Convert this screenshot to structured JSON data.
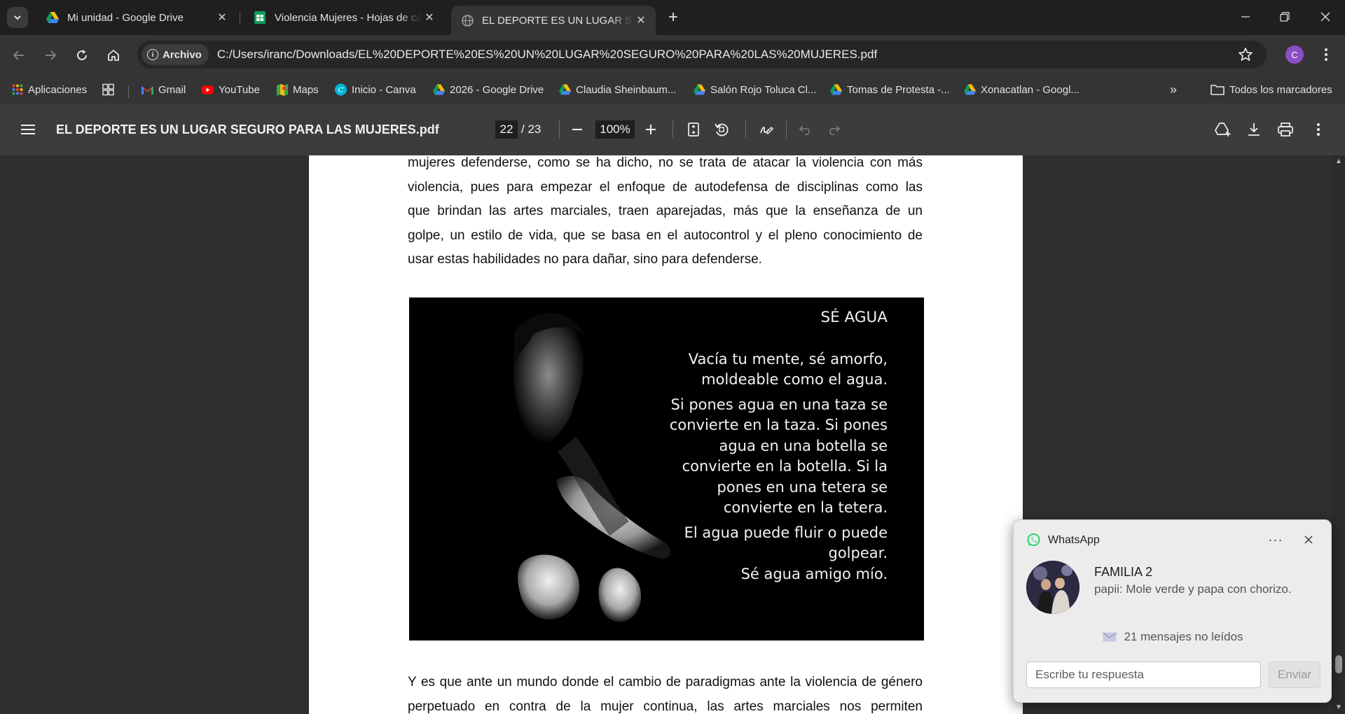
{
  "tabs": [
    {
      "title": "Mi unidad - Google Drive",
      "icon": "google-drive-icon",
      "active": false
    },
    {
      "title": "Violencia Mujeres - Hojas de cálculo",
      "icon": "google-sheets-icon",
      "active": false
    },
    {
      "title": "EL DEPORTE ES UN LUGAR SEGURO PARA LAS MUJERES.pdf",
      "icon": "globe-icon",
      "active": true
    }
  ],
  "omnibox": {
    "chip_label": "Archivo",
    "url": "C:/Users/iranc/Downloads/EL%20DEPORTE%20ES%20UN%20LUGAR%20SEGURO%20PARA%20LAS%20MUJERES.pdf"
  },
  "profile_initial": "C",
  "bookmarks": [
    {
      "label": "Aplicaciones",
      "icon": "apps-grid-icon"
    },
    {
      "label": "Gmail",
      "icon": "gmail-icon"
    },
    {
      "label": "YouTube",
      "icon": "youtube-icon"
    },
    {
      "label": "Maps",
      "icon": "maps-icon"
    },
    {
      "label": "Inicio - Canva",
      "icon": "canva-icon"
    },
    {
      "label": "2026 - Google Drive",
      "icon": "google-drive-icon"
    },
    {
      "label": "Claudia Sheinbaum...",
      "icon": "google-drive-icon"
    },
    {
      "label": "Salón Rojo Toluca Cl...",
      "icon": "google-drive-icon"
    },
    {
      "label": "Tomas de Protesta -...",
      "icon": "google-drive-icon"
    },
    {
      "label": "Xonacatlan - Googl...",
      "icon": "google-drive-icon"
    }
  ],
  "all_bookmarks_label": "Todos los marcadores",
  "pdf": {
    "title": "EL DEPORTE ES UN LUGAR SEGURO PARA LAS MUJERES.pdf",
    "current_page": "22",
    "total_pages": "/ 23",
    "zoom": "100%"
  },
  "document": {
    "para1_lines": [
      "mujeres defenderse, como se ha dicho, no se trata de atacar la violencia con más",
      "violencia, pues para empezar el enfoque de autodefensa de disciplinas como las",
      "que brindan las artes marciales, traen aparejadas, más que la enseñanza de un",
      "golpe, un estilo de vida, que se basa en el autocontrol y el pleno conocimiento de",
      "usar estas habilidades no para dañar, sino para defenderse."
    ],
    "image_quote": {
      "title": "SÉ AGUA",
      "blocks": [
        [
          "Vacía tu mente, sé amorfo,",
          "moldeable como el agua."
        ],
        [
          "Si pones agua en una taza se",
          "convierte en la taza. Si pones",
          "agua en una botella se",
          "convierte en la botella. Si la",
          "pones en una tetera se",
          "convierte en la tetera."
        ],
        [
          "El agua puede fluir o puede",
          "golpear."
        ],
        [
          "Sé agua amigo mío."
        ]
      ]
    },
    "para2_lines": [
      "Y es que ante un mundo donde el cambio de paradigmas ante la violencia de género",
      "perpetuado en contra de la mujer continua, las artes marciales nos permiten"
    ]
  },
  "notification": {
    "app": "WhatsApp",
    "sender": "FAMILIA 2",
    "message": "papii: Mole verde y papa con chorizo.",
    "unread": "21 mensajes no leídos",
    "reply_placeholder": "Escribe tu respuesta",
    "send_label": "Enviar"
  },
  "colors": {
    "tabstrip_bg": "#1f1f1f",
    "toolbar_bg": "#343434",
    "pdf_toolbar_bg": "#3c3c3c",
    "viewer_bg": "#2f2f2f",
    "whatsapp_green": "#25d366"
  }
}
